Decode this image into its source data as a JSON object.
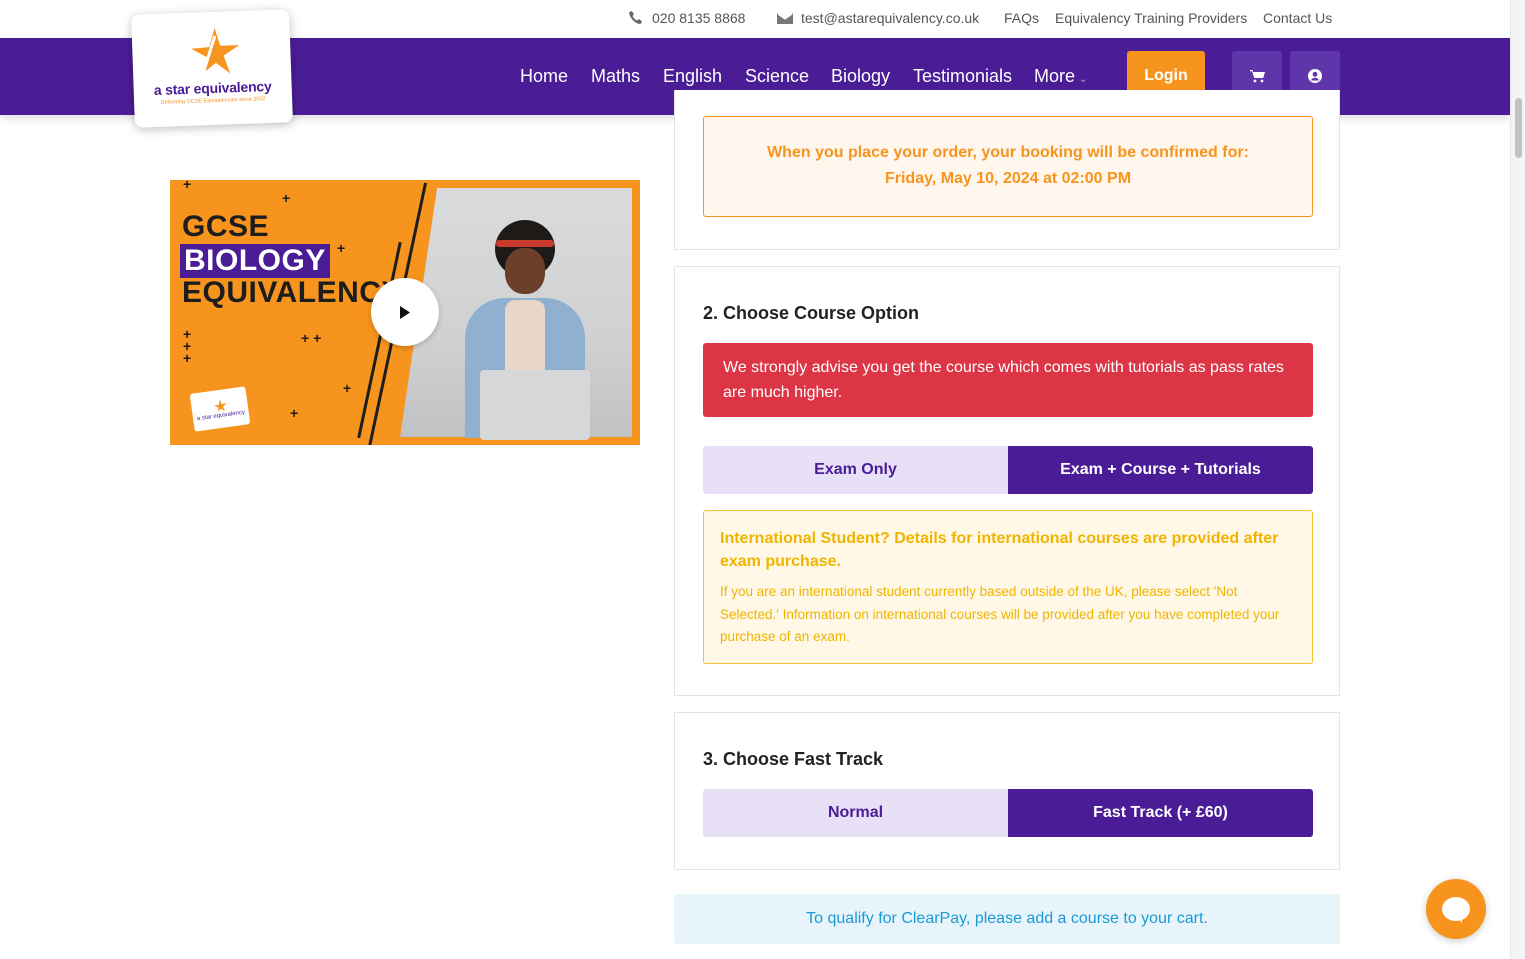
{
  "topbar": {
    "phone": "020 8135 8868",
    "email": "test@astarequivalency.co.uk",
    "faqs": "FAQs",
    "providers": "Equivalency Training Providers",
    "contact": "Contact Us"
  },
  "logo": {
    "brand": "a star equivalency",
    "tagline": "Delivering GCSE Equivalencies since 2002"
  },
  "nav": {
    "items": [
      "Home",
      "Maths",
      "English",
      "Science",
      "Biology",
      "Testimonials"
    ],
    "more": "More",
    "login": "Login"
  },
  "video": {
    "line1": "GCSE",
    "line2": "BIOLOGY",
    "line3": "EQUIVALENCY",
    "mini_logo": "a star equivalency"
  },
  "booking": {
    "line1": "When you place your order, your booking will be confirmed for:",
    "line2": "Friday, May 10, 2024 at 02:00 PM"
  },
  "course_option": {
    "title": "2. Choose Course Option",
    "advice": "We strongly advise you get the course which comes with tutorials as pass rates are much higher.",
    "option_a": "Exam Only",
    "option_b": "Exam + Course + Tutorials",
    "selected": "Exam + Course + Tutorials",
    "intl_heading": "International Student? Details for international courses are provided after exam purchase.",
    "intl_body": "If you are an international student currently based outside of the UK, please select 'Not Selected.' Information on international courses will be provided after you have completed your purchase of an exam."
  },
  "fast_track": {
    "title": "3. Choose Fast Track",
    "option_a": "Normal",
    "option_b": "Fast Track (+ £60)",
    "selected": "Fast Track (+ £60)"
  },
  "clearpay": {
    "text": "To qualify for ClearPay, please add a course to your cart."
  },
  "colors": {
    "brand_purple": "#4a1d96",
    "brand_orange": "#f7941d",
    "alert_red": "#dc3545",
    "info_blue": "#1a9ad6"
  }
}
